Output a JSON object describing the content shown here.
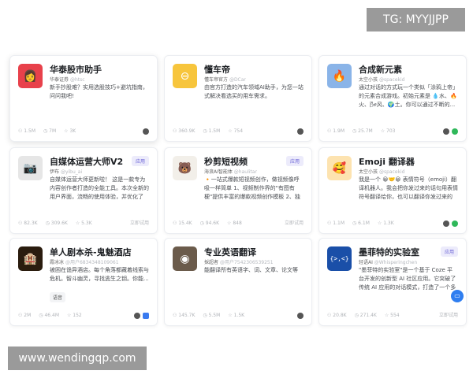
{
  "watermarks": {
    "top": "TG: MYYJJPP",
    "bottom": "www.wendingqp.com"
  },
  "badge_label": "应用",
  "try_label": "立即试用",
  "cards": [
    {
      "title": "华泰股市助手",
      "author": "华泰证券",
      "handle": "@htsc",
      "desc": "新手抄股难？实用选股技巧+避坑指南，问问我吧!",
      "users": "1.5M",
      "chats": "7M",
      "stars": "3K",
      "icon": "avatar-woman",
      "color": "#e8414b",
      "glyph": "👩"
    },
    {
      "title": "懂车帝",
      "author": "懂车帝官方",
      "handle": "@DCar",
      "desc": "由官方打造的汽车领域AI助手，为您一站式解决看选买的用车需求。",
      "users": "360.9K",
      "chats": "1.5M",
      "stars": "754",
      "icon": "steering-wheel",
      "color": "#f7c53c",
      "glyph": "⊖"
    },
    {
      "title": "合成新元素",
      "author": "太空小孩",
      "handle": "@spacekid",
      "desc": "通过对话的方式玩一个类似「涂鸦上帝」的元素合成游戏。初始元素是 💧水、🔥火、🌬风、🌍土。你可以通过不断的...",
      "users": "1.9M",
      "chats": "25.7M",
      "stars": "703",
      "icon": "elements",
      "color": "#8ab4e8",
      "glyph": "🔥"
    },
    {
      "title": "自媒体运营大师V2",
      "author": "伊布",
      "handle": "@yibu_ai",
      "desc": "自媒体运营大师更新啦！ 这是一款专为内容创作者打造的全能工具。本次全新的用户界面，流畅的使用体验，并优化了核...",
      "users": "82.3K",
      "chats": "309.6K",
      "stars": "5.3K",
      "icon": "camera",
      "color": "#e6e6e6",
      "glyph": "📷",
      "badge": true,
      "try": true
    },
    {
      "title": "秒剪短视频",
      "author": "海浪AI智能体",
      "handle": "@haulitar",
      "desc": "🔸一站式爆款短视频创作，做视频像呼吸一样简单 1、视频制作界的\"有图有梗\"提供丰富的爆款视频创作模板 2、独创剪...",
      "users": "15.4K",
      "chats": "94.6K",
      "stars": "848",
      "icon": "bear",
      "color": "#f2efe9",
      "glyph": "🐻",
      "badge": true,
      "try": true
    },
    {
      "title": "Emoji 翻译器",
      "author": "太空小孩",
      "handle": "@spacekid",
      "desc": "我是一个 😀🤝😀 表情符号（emoji）翻译机器人。我会把你发过来的话句用表情符号翻译给你，也可以翻译你发过来的表...",
      "users": "1.1M",
      "chats": "6.1M",
      "stars": "1.3K",
      "icon": "emoji-face",
      "color": "#fde3b0",
      "glyph": "🥰"
    },
    {
      "title": "单人剧本杀-鬼魅酒店",
      "author": "霞冰冰",
      "handle": "@用户6834348109061",
      "desc": "被困在诡异酒店。每个角落都藏着线索与危机。智斗幽灵，寻找逃生之钥。你能...",
      "tag": "语音",
      "users": "2M",
      "chats": "46.4M",
      "stars": "152",
      "icon": "hotel",
      "color": "#2a1c0e",
      "glyph": "🏨"
    },
    {
      "title": "专业英语翻译",
      "author": "採超者",
      "handle": "@用户7542306539251",
      "desc": "能翻译所有英语字、词、文章、论文等",
      "users": "145.7K",
      "chats": "5.5M",
      "stars": "1.5K",
      "icon": "seal",
      "color": "#6b5b4b",
      "glyph": "◉"
    },
    {
      "title": "墨菲特的实验室",
      "author": "轻语AI",
      "handle": "@Whisperingchen",
      "desc": "\"墨菲特的实验室\"是一个基于 Coze 平台开发的创新型 AI 社区应用。它突破了传统 AI 应用的对话模式，打造了一个多功能...",
      "users": "20.8K",
      "chats": "271.4K",
      "stars": "554",
      "icon": "code-brackets",
      "color": "#1a4fa8",
      "glyph": "{>,<}",
      "badge": true,
      "try": true
    }
  ]
}
